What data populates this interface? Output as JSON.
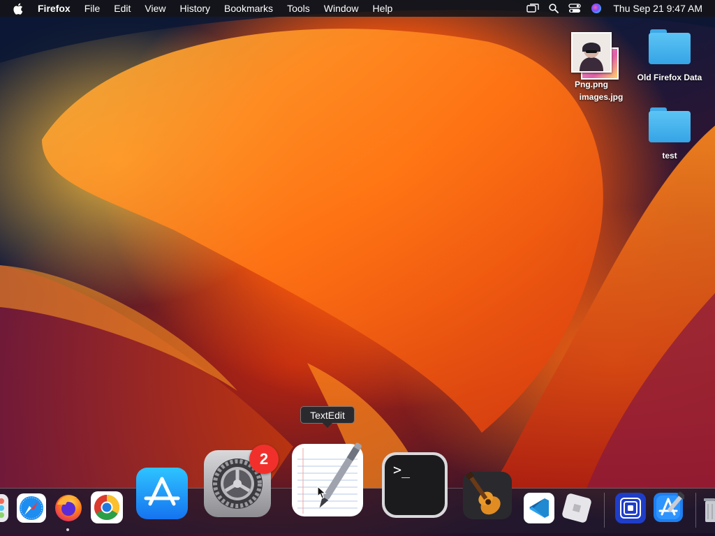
{
  "menubar": {
    "app_name": "Firefox",
    "items": [
      "File",
      "Edit",
      "View",
      "History",
      "Bookmarks",
      "Tools",
      "Window",
      "Help"
    ],
    "clock": "Thu Sep 21  9:47 AM"
  },
  "desktop": {
    "png_label": "Png.png",
    "jpg_label": "images.jpg",
    "folder1_label": "Old Firefox Data",
    "folder2_label": "test"
  },
  "dock": {
    "tooltip": "TextEdit",
    "settings_badge": "2",
    "apps": [
      "Launchpad",
      "Safari",
      "Firefox",
      "Google Chrome",
      "App Store",
      "System Settings",
      "TextEdit",
      "Terminal",
      "GarageBand",
      "Visual Studio Code",
      "Roblox",
      "Simulator",
      "Xcode"
    ]
  },
  "colors": {
    "menubar_bg": "#141418",
    "badge": "#f2302b",
    "folder": "#4ab6ee"
  }
}
